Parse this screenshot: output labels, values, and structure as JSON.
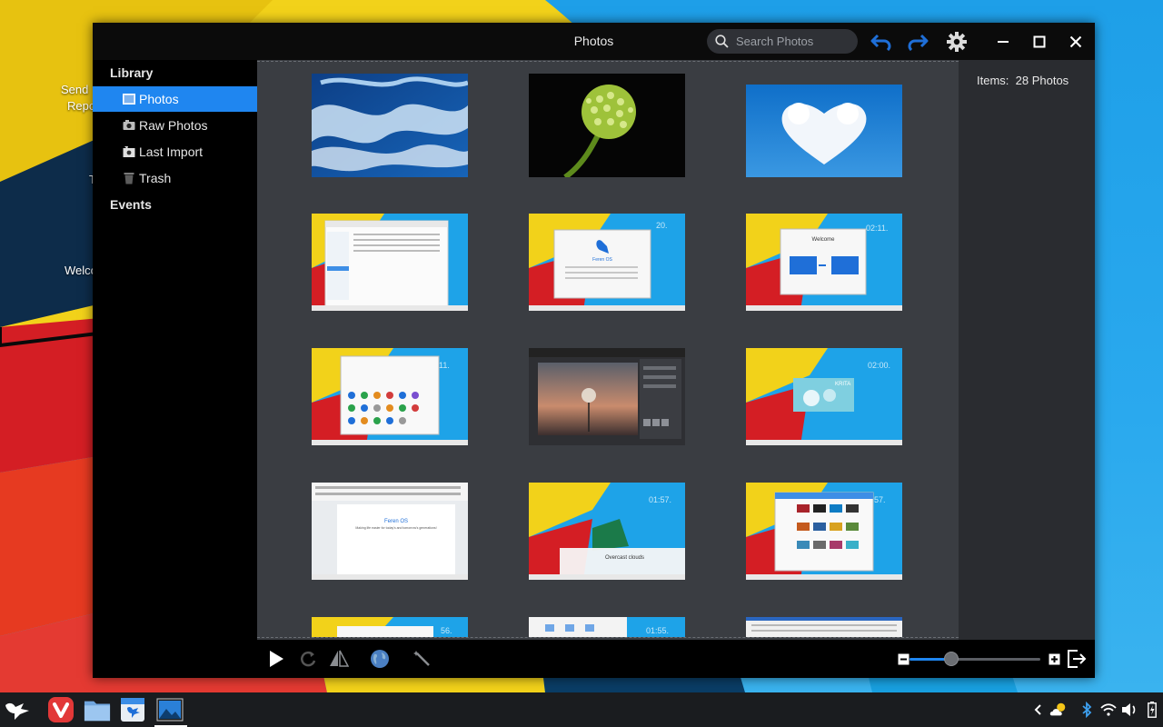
{
  "desktop": {
    "labels": [
      "Send",
      "Repo",
      "T",
      "Welco"
    ]
  },
  "window": {
    "title": "Photos",
    "search_placeholder": "Search Photos",
    "controls": {
      "undo_icon": "undo-arrow-icon",
      "redo_icon": "redo-arrow-icon",
      "settings_icon": "gear-icon",
      "minimize_icon": "minimize-icon",
      "maximize_icon": "maximize-icon",
      "close_icon": "close-icon"
    },
    "accent": "#1f86f0"
  },
  "sidebar": {
    "library_label": "Library",
    "items": [
      {
        "label": "Photos",
        "icon": "photos-icon",
        "selected": true
      },
      {
        "label": "Raw Photos",
        "icon": "camera-icon",
        "selected": false
      },
      {
        "label": "Last Import",
        "icon": "import-icon",
        "selected": false
      },
      {
        "label": "Trash",
        "icon": "trash-icon",
        "selected": false
      }
    ],
    "events_label": "Events"
  },
  "info": {
    "items_label": "Items:",
    "items_value": "28 Photos"
  },
  "thumbnails": [
    {
      "name": "ocean-waves",
      "kind": "water"
    },
    {
      "name": "green-flower",
      "kind": "flower"
    },
    {
      "name": "heart-cloud",
      "kind": "cloud"
    },
    {
      "name": "screenshot-file-manager",
      "kind": "screen"
    },
    {
      "name": "screenshot-feren-os-about",
      "kind": "screen"
    },
    {
      "name": "screenshot-welcome",
      "kind": "screen"
    },
    {
      "name": "screenshot-app-launcher",
      "kind": "screen"
    },
    {
      "name": "screenshot-image-editor",
      "kind": "editor"
    },
    {
      "name": "screenshot-krita",
      "kind": "screen"
    },
    {
      "name": "screenshot-document",
      "kind": "screen"
    },
    {
      "name": "screenshot-weather",
      "kind": "screen"
    },
    {
      "name": "screenshot-themes",
      "kind": "screen"
    },
    {
      "name": "screenshot-partial-1",
      "kind": "screen"
    },
    {
      "name": "screenshot-partial-2",
      "kind": "screen"
    },
    {
      "name": "screenshot-partial-3",
      "kind": "screen"
    }
  ],
  "thumb_overlays": {
    "t4": "20.",
    "t5": "02:11.",
    "t6": "11.",
    "t8": "02:00.",
    "t10": "01:57.",
    "t11": "57.",
    "t12": "56.",
    "t13": "01:55.",
    "welcome_title": "Welcome",
    "feren_title": "Feren OS",
    "doc_title": "Feren OS",
    "doc_sub": "Making life easier for today's and tomorrow's generations!",
    "weather_text": "Overcast clouds",
    "krita_text": "KRITA"
  },
  "bottombar": {
    "play_icon": "play-icon",
    "rotate_icon": "rotate-icon",
    "flip_icon": "flip-icon",
    "publish_icon": "globe-icon",
    "enhance_icon": "magic-wand-icon",
    "zoom_out_icon": "zoom-out-icon",
    "zoom_in_icon": "zoom-in-icon",
    "fullscreen_icon": "fullscreen-exit-icon",
    "zoom_level": 0.3
  },
  "taskbar": {
    "apps": [
      {
        "name": "start-menu",
        "icon": "feren-bird-icon"
      },
      {
        "name": "vivaldi",
        "icon": "vivaldi-icon"
      },
      {
        "name": "files",
        "icon": "folder-icon"
      },
      {
        "name": "store",
        "icon": "store-icon"
      },
      {
        "name": "photos",
        "icon": "photos-app-icon",
        "active": true
      }
    ],
    "tray": [
      "chevron-left-icon",
      "weather-icon",
      "bluetooth-icon",
      "wifi-icon",
      "volume-icon",
      "battery-icon"
    ]
  }
}
